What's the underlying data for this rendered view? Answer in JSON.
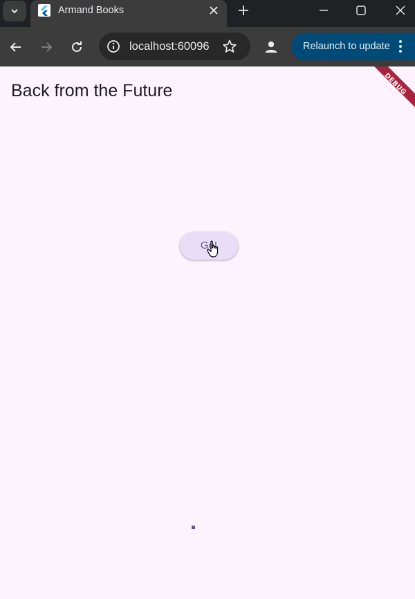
{
  "browser": {
    "tab": {
      "title": "Armand Books",
      "favicon": "flutter-icon"
    },
    "address_bar": {
      "url": "localhost:60096"
    },
    "relaunch_label": "Relaunch to update",
    "icons": {
      "tab_search": "chevron-down-icon",
      "tab_close": "close-icon",
      "new_tab": "plus-icon",
      "minimize": "minimize-icon",
      "maximize": "maximize-icon",
      "window_close": "close-icon",
      "back": "arrow-left-icon",
      "forward": "arrow-right-icon",
      "reload": "reload-icon",
      "site_info": "info-icon",
      "bookmark": "star-icon",
      "profile": "person-icon",
      "menu": "kebab-icon"
    }
  },
  "app": {
    "title": "Back from the Future",
    "go_button_label": "Go!",
    "debug_banner": "DEBUG",
    "colors": {
      "background": "#fdf3fe",
      "button": "#e8def8",
      "button_text": "#65558f",
      "debug": "#a6243d"
    }
  }
}
